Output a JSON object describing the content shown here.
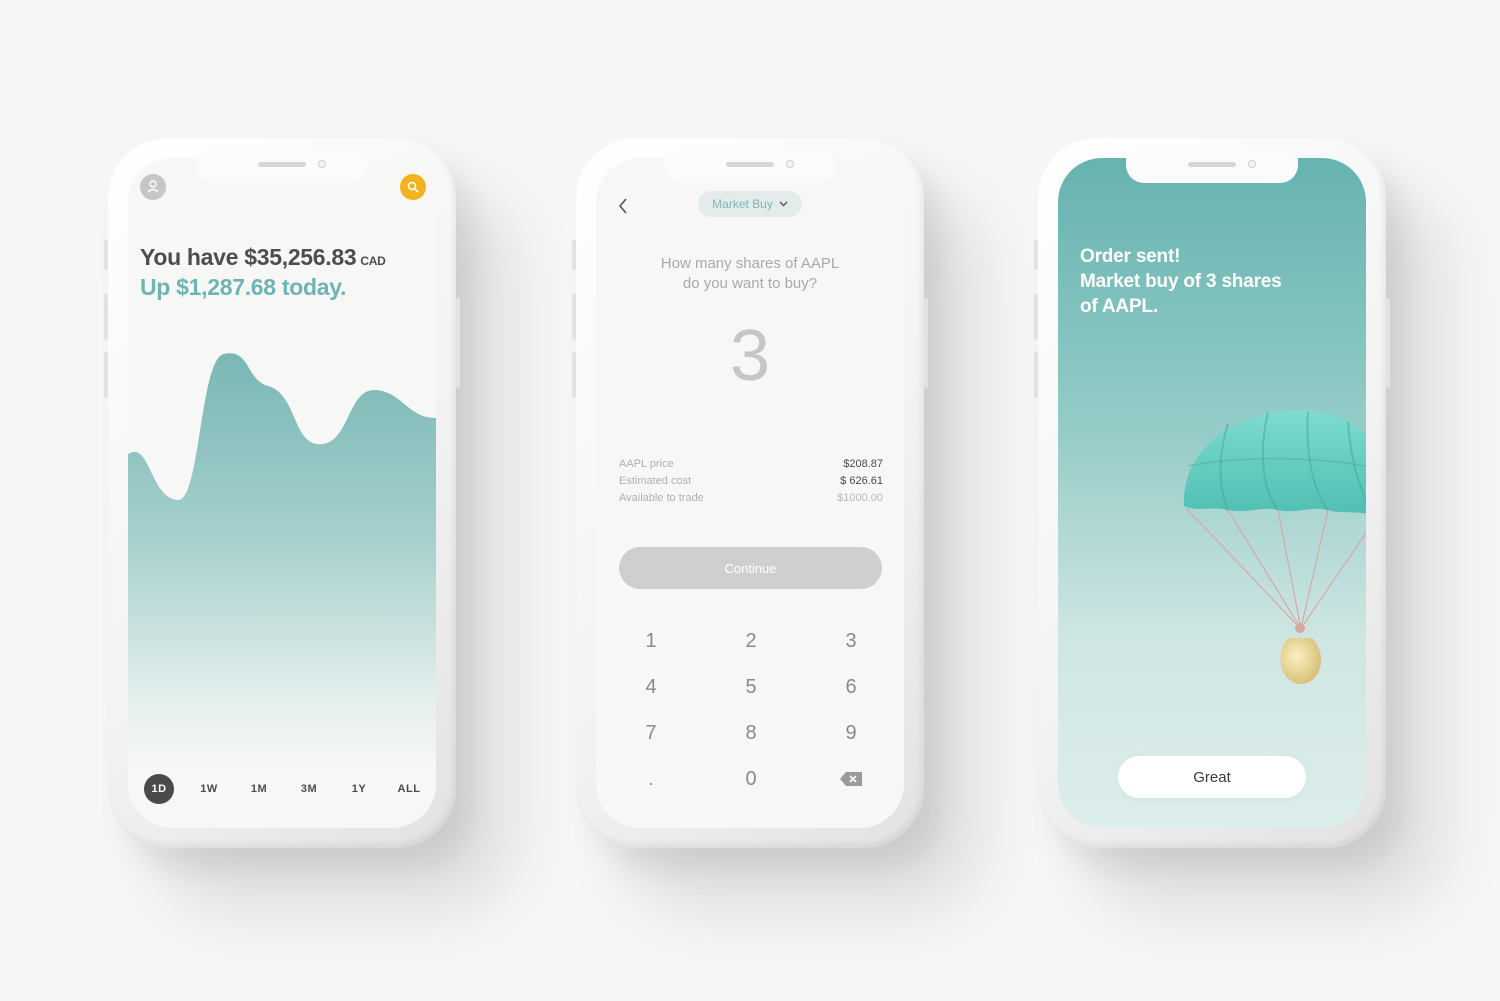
{
  "portfolio": {
    "balance_prefix": "You have ",
    "balance_amount": "$35,256.83",
    "currency": "CAD",
    "gain_text": "Up $1,287.68 today.",
    "ranges": [
      "1D",
      "1W",
      "1M",
      "3M",
      "1Y",
      "ALL"
    ],
    "selected_range": "1D",
    "accent": "#6fb4b4",
    "search_color": "#f3b21f"
  },
  "trade": {
    "order_type": "Market Buy",
    "question": "How many shares of AAPL\ndo you want to buy?",
    "quantity": "3",
    "summary": [
      {
        "label": "AAPL price",
        "value": "$208.87"
      },
      {
        "label": "Estimated cost",
        "value": "$ 626.61"
      },
      {
        "label": "Available to trade",
        "value": "$1000.00"
      }
    ],
    "continue_label": "Continue",
    "keypad": [
      [
        "1",
        "2",
        "3"
      ],
      [
        "4",
        "5",
        "6"
      ],
      [
        "7",
        "8",
        "9"
      ],
      [
        ".",
        "0",
        "backspace-icon"
      ]
    ]
  },
  "confirmation": {
    "line1": "Order sent!",
    "line2": "Market buy of 3 shares",
    "line3": "of AAPL.",
    "button_label": "Great"
  }
}
